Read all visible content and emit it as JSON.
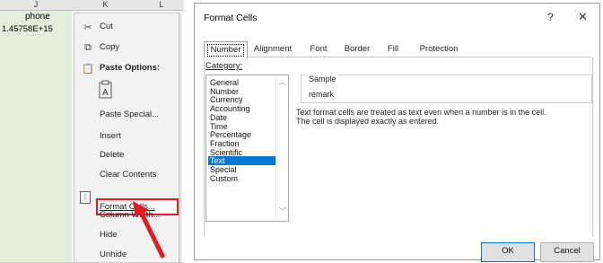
{
  "spreadsheet": {
    "columns": [
      "J",
      "K",
      "L"
    ],
    "header_cell": "phone",
    "value_cell": "1.45758E+15"
  },
  "context_menu": {
    "items": {
      "cut": "Cut",
      "copy": "Copy",
      "paste_options": "Paste Options:",
      "paste_special": "Paste Special...",
      "insert": "Insert",
      "delete": "Delete",
      "clear_contents": "Clear Contents",
      "format_cells": "Format Cells...",
      "column_width": "Column Width...",
      "hide": "Hide",
      "unhide": "Unhide"
    },
    "highlight_color": "#e31b23"
  },
  "dialog": {
    "title": "Format Cells",
    "help": "?",
    "close": "✕",
    "tabs": [
      "Number",
      "Alignment",
      "Font",
      "Border",
      "Fill",
      "Protection"
    ],
    "active_tab": "Number",
    "category_label": "Category:",
    "categories": [
      "General",
      "Number",
      "Currency",
      "Accounting",
      "Date",
      "Time",
      "Percentage",
      "Fraction",
      "Scientific",
      "Text",
      "Special",
      "Custom"
    ],
    "selected_category": "Text",
    "sample_label": "Sample",
    "sample_value": "remark",
    "description_line1": "Text format cells are treated as text even when a number is in the cell.",
    "description_line2": "The cell is displayed exactly as entered.",
    "ok_label": "OK",
    "cancel_label": "Cancel",
    "accent_color": "#0078d7"
  }
}
